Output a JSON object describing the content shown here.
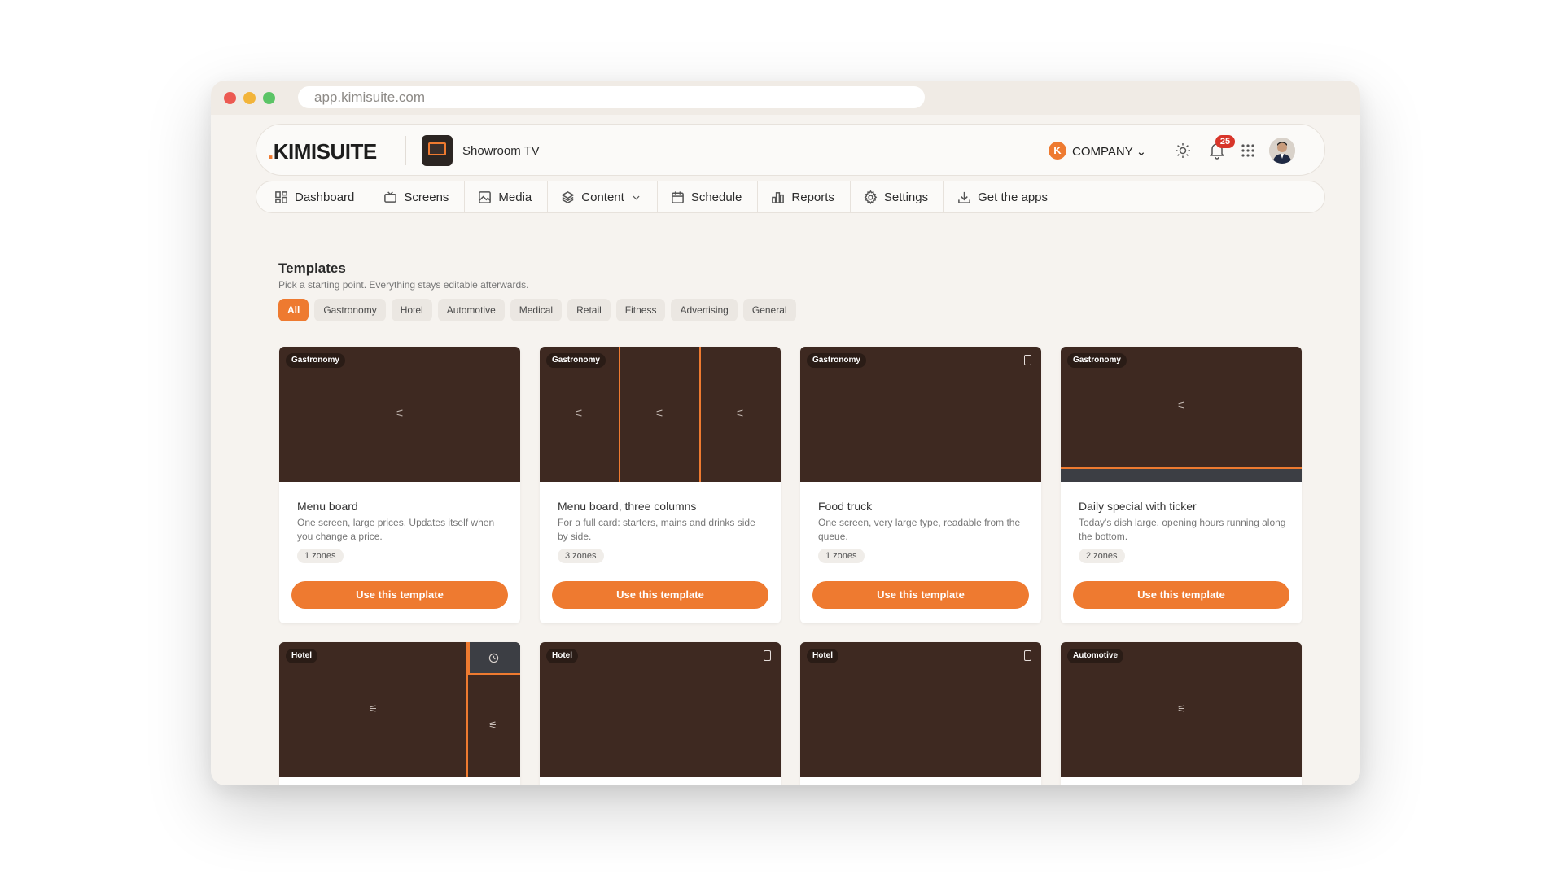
{
  "browser": {
    "url": "app.kimisuite.com"
  },
  "header": {
    "logo_mark": ".",
    "logo_text": "KIMISUITE",
    "screen_name": "Showroom TV",
    "company_initial": "K",
    "company_label": "COMPANY",
    "notification_count": "25"
  },
  "nav": {
    "items": [
      {
        "label": "Dashboard",
        "icon": "dashboard-icon"
      },
      {
        "label": "Screens",
        "icon": "tv-icon"
      },
      {
        "label": "Media",
        "icon": "image-icon"
      },
      {
        "label": "Content",
        "icon": "layers-icon"
      },
      {
        "label": "Schedule",
        "icon": "calendar-icon"
      },
      {
        "label": "Reports",
        "icon": "bar-chart-icon"
      },
      {
        "label": "Settings",
        "icon": "gear-icon"
      },
      {
        "label": "Get the apps",
        "icon": "download-icon"
      }
    ]
  },
  "page": {
    "title": "Templates",
    "subtitle": "Pick a starting point. Everything stays editable afterwards."
  },
  "filters": [
    "All",
    "Gastronomy",
    "Hotel",
    "Automotive",
    "Medical",
    "Retail",
    "Fitness",
    "Advertising",
    "General"
  ],
  "cards": [
    {
      "tag": "Gastronomy",
      "title": "Menu board",
      "desc": "One screen, large prices. Updates itself when you change a price.",
      "zones": "1 zones",
      "button": "Use this template"
    },
    {
      "tag": "Gastronomy",
      "title": "Menu board, three columns",
      "desc": "For a full card: starters, mains and drinks side by side.",
      "zones": "3 zones",
      "button": "Use this template"
    },
    {
      "tag": "Gastronomy",
      "title": "Food truck",
      "desc": "One screen, very large type, readable from the queue.",
      "zones": "1 zones",
      "button": "Use this template"
    },
    {
      "tag": "Gastronomy",
      "title": "Daily special with ticker",
      "desc": "Today's dish large, opening hours running along the bottom.",
      "zones": "2 zones",
      "button": "Use this template"
    },
    {
      "tag": "Hotel"
    },
    {
      "tag": "Hotel"
    },
    {
      "tag": "Hotel"
    },
    {
      "tag": "Automotive"
    }
  ],
  "colors": {
    "accent": "#ee7a30",
    "preview_bg": "#3e2921"
  }
}
